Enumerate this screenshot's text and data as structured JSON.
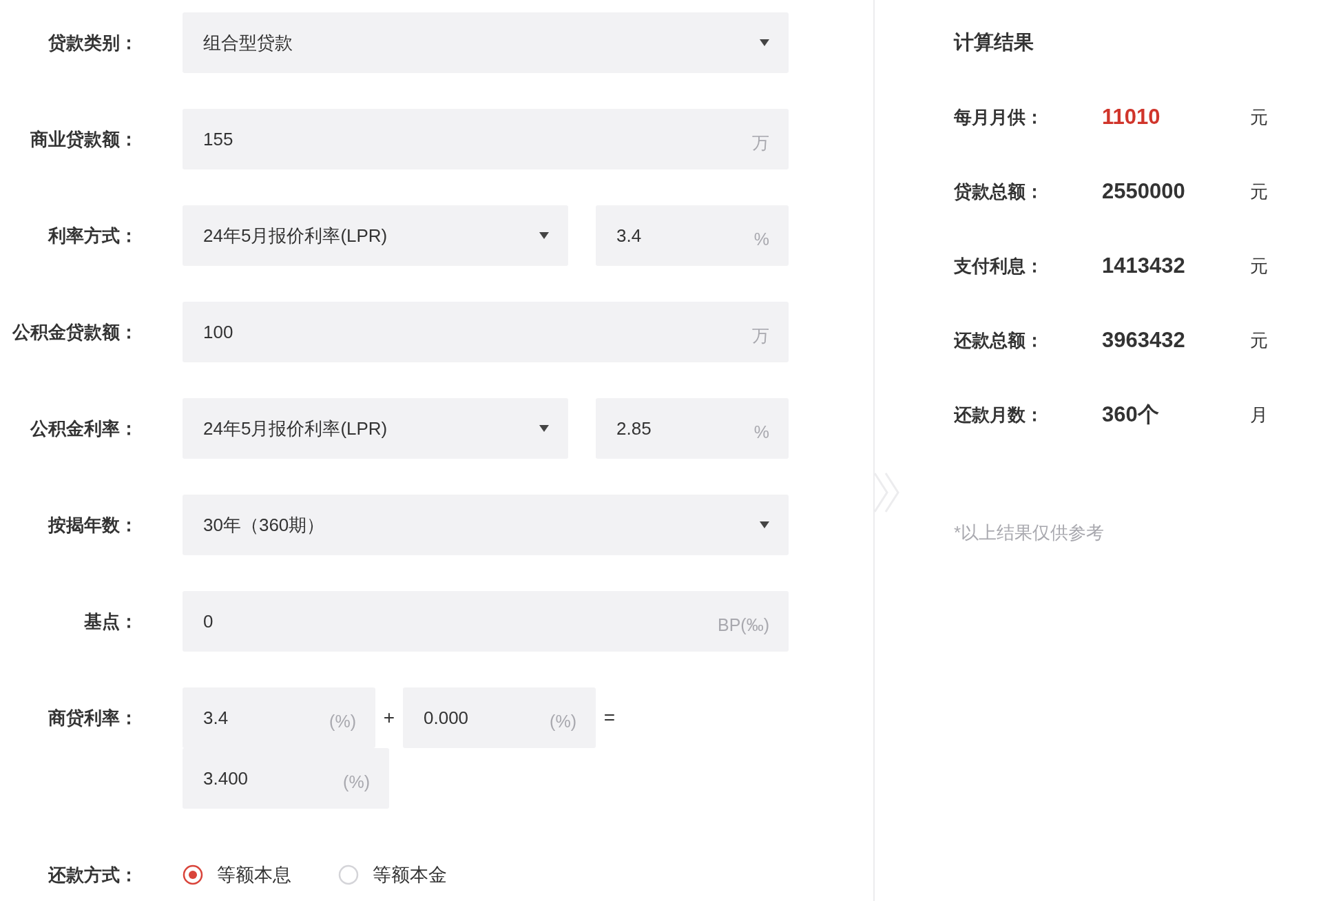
{
  "form": {
    "rows": [
      {
        "kind": "select",
        "label": "贷款类别：",
        "value": "组合型贷款"
      },
      {
        "kind": "input",
        "label": "商业贷款额：",
        "value": "155",
        "unit": "万"
      },
      {
        "kind": "select_input",
        "label": "利率方式：",
        "value": "24年5月报价利率(LPR)",
        "rate": "3.4",
        "unit": "%"
      },
      {
        "kind": "input",
        "label": "公积金贷款额：",
        "value": "100",
        "unit": "万"
      },
      {
        "kind": "select_input",
        "label": "公积金利率：",
        "value": "24年5月报价利率(LPR)",
        "rate": "2.85",
        "unit": "%"
      },
      {
        "kind": "select",
        "label": "按揭年数：",
        "value": "30年（360期）"
      },
      {
        "kind": "input",
        "label": "基点：",
        "value": "0",
        "unit": "BP(‰)"
      },
      {
        "kind": "sum",
        "label": "商贷利率：",
        "terms": [
          {
            "value": "3.4",
            "unit": "(%)"
          },
          {
            "value": "0.000",
            "unit": "(%)"
          }
        ],
        "operators": [
          "+",
          "="
        ],
        "result": {
          "value": "3.400",
          "unit": "(%)"
        }
      },
      {
        "kind": "radio",
        "label": "还款方式：",
        "options": [
          {
            "label": "等额本息",
            "selected": true
          },
          {
            "label": "等额本金",
            "selected": false
          }
        ]
      }
    ]
  },
  "results": {
    "title": "计算结果",
    "rows": [
      {
        "label": "每月月供：",
        "value": "11010",
        "unit": "元",
        "highlight": true
      },
      {
        "label": "贷款总额：",
        "value": "2550000",
        "unit": "元",
        "highlight": false
      },
      {
        "label": "支付利息：",
        "value": "1413432",
        "unit": "元",
        "highlight": false
      },
      {
        "label": "还款总额：",
        "value": "3963432",
        "unit": "元",
        "highlight": false
      },
      {
        "label": "还款月数：",
        "value": "360个",
        "unit": "月",
        "highlight": false
      }
    ],
    "note": "*以上结果仅供参考"
  }
}
